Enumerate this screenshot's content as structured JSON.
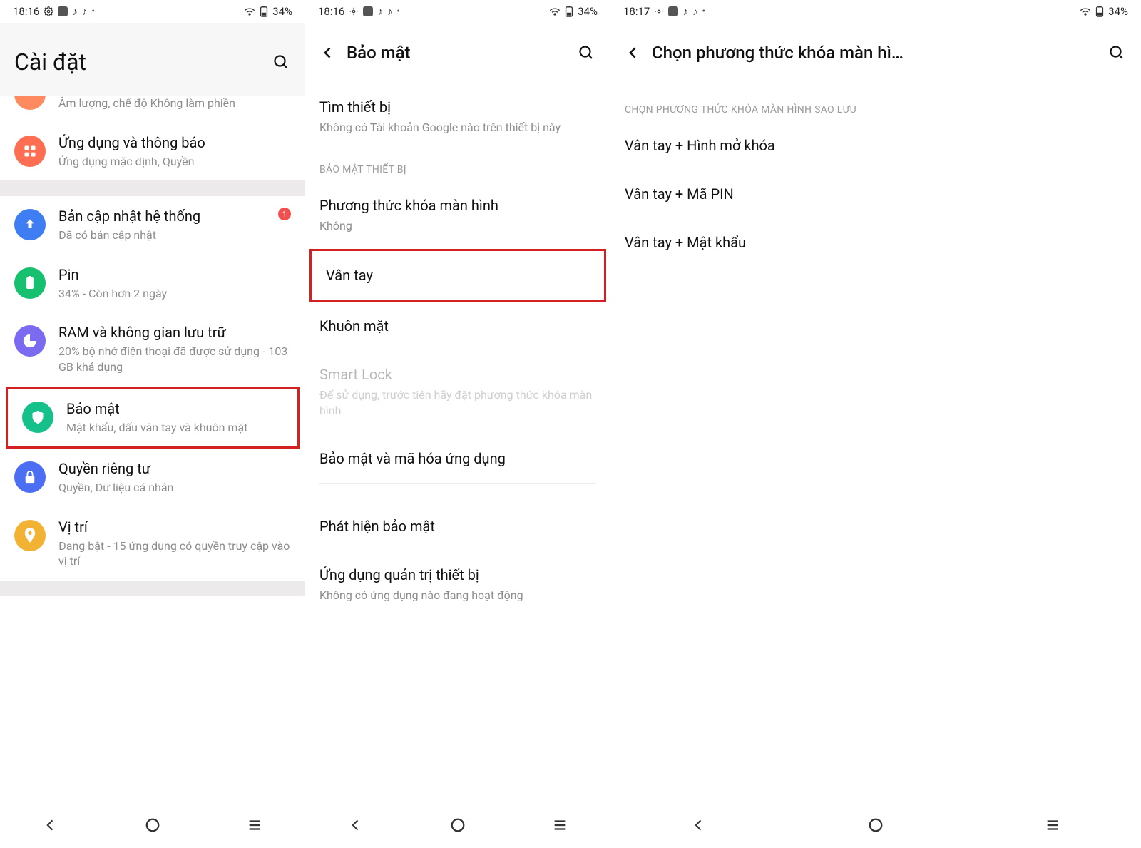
{
  "status": {
    "times": [
      "18:16",
      "18:16",
      "18:17"
    ],
    "battery": "34%"
  },
  "screen1": {
    "title": "Cài đặt",
    "items": {
      "volume_sub": "Âm lượng, chế độ Không làm phiền",
      "apps": {
        "title": "Ứng dụng và thông báo",
        "sub": "Ứng dụng mặc định, Quyền"
      },
      "update": {
        "title": "Bản cập nhật hệ thống",
        "sub": "Đã có bản cập nhật",
        "badge": "1"
      },
      "battery": {
        "title": "Pin",
        "sub": "34% - Còn hơn 2 ngày"
      },
      "storage": {
        "title": "RAM và không gian lưu trữ",
        "sub": "20% bộ nhớ điện thoại đã được sử dụng - 103 GB khả dụng"
      },
      "security": {
        "title": "Bảo mật",
        "sub": "Mật khẩu, dấu vân tay và khuôn mặt"
      },
      "privacy": {
        "title": "Quyền riêng tư",
        "sub": "Quyền, Dữ liệu cá nhân"
      },
      "location": {
        "title": "Vị trí",
        "sub": "Đang bật - 15 ứng dụng có quyền truy cập vào vị trí"
      }
    }
  },
  "screen2": {
    "title": "Bảo mật",
    "find": {
      "title": "Tìm thiết bị",
      "sub": "Không có Tài khoản Google nào trên thiết bị này"
    },
    "section_device": "BẢO MẬT THIẾT BỊ",
    "lock": {
      "title": "Phương thức khóa màn hình",
      "sub": "Không"
    },
    "fingerprint": "Vân tay",
    "face": "Khuôn mặt",
    "smartlock": {
      "title": "Smart Lock",
      "sub": "Để sử dụng, trước tiên hãy đặt phương thức khóa màn hình"
    },
    "appsec": "Bảo mật và mã hóa ứng dụng",
    "detect": "Phát hiện bảo mật",
    "admin": {
      "title": "Ứng dụng quản trị thiết bị",
      "sub": "Không có ứng dụng nào đang hoạt động"
    }
  },
  "screen3": {
    "title": "Chọn phương thức khóa màn hì…",
    "section": "CHỌN PHƯƠNG THỨC KHÓA MÀN HÌNH SAO LƯU",
    "options": [
      "Vân tay + Hình mở khóa",
      "Vân tay + Mã PIN",
      "Vân tay + Mật khẩu"
    ]
  }
}
